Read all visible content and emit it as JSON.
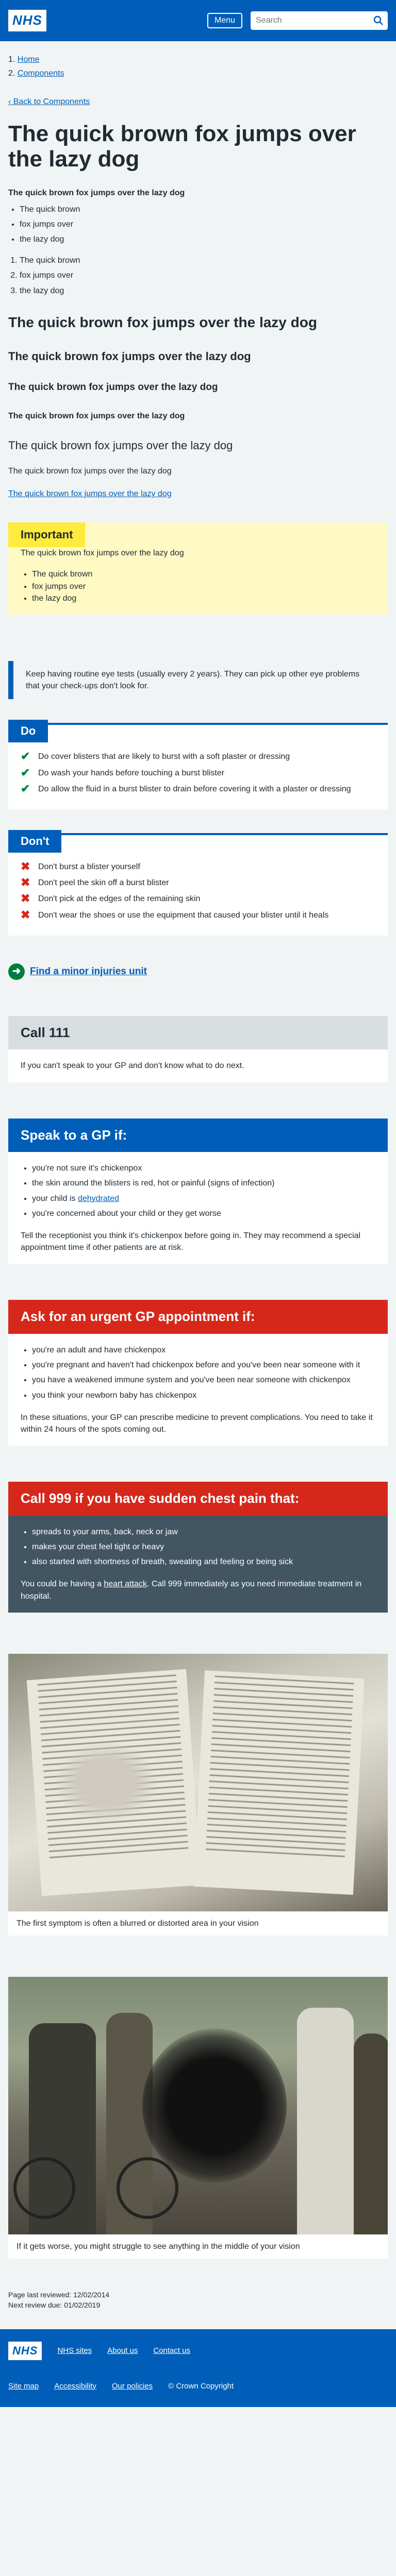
{
  "header": {
    "logo": "NHS",
    "menu": "Menu",
    "search_placeholder": "Search"
  },
  "breadcrumbs": [
    "Home",
    "Components"
  ],
  "back_link": "Back to Components",
  "title": "The quick brown fox jumps over the lazy dog",
  "bold_para": "The quick brown fox jumps over the lazy dog",
  "bullets": [
    "The quick brown",
    "fox jumps over",
    "the lazy dog"
  ],
  "numbered": [
    "The quick brown",
    "fox jumps over",
    "the lazy dog"
  ],
  "headings": {
    "h2": "The quick brown fox jumps over the lazy dog",
    "h3": "The quick brown fox jumps over the lazy dog",
    "h4": "The quick brown fox jumps over the lazy dog",
    "h5": "The quick brown fox jumps over the lazy dog",
    "normal": "The quick brown fox jumps over the lazy dog",
    "para": "The quick brown fox jumps over the lazy dog",
    "link": "The quick brown fox jumps over the lazy dog"
  },
  "important": {
    "tag": "Important",
    "text": "The quick brown fox jumps over the lazy dog",
    "items": [
      "The quick brown",
      "fox jumps over",
      "the lazy dog"
    ]
  },
  "inset_text": "Keep having routine eye tests (usually every 2 years). They can pick up other eye problems that your check-ups don't look for.",
  "do": {
    "tag": "Do",
    "items": [
      "Do cover blisters that are likely to burst with a soft plaster or dressing",
      "Do wash your hands before touching a burst blister",
      "Do allow the fluid in a burst blister to drain before covering it with a plaster or dressing"
    ]
  },
  "dont": {
    "tag": "Don't",
    "items": [
      "Don't burst a blister yourself",
      "Don't peel the skin off a burst blister",
      "Don't pick at the edges of the remaining skin",
      "Don't wear the shoes or use the equipment that caused your blister until it heals"
    ]
  },
  "action_link": "Find a minor injuries unit",
  "care_111": {
    "heading": "Call 111",
    "text": "If you can't speak to your GP and don't know what to do next."
  },
  "care_gp": {
    "heading": "Speak to a GP if:",
    "items": [
      "you're not sure it's chickenpox",
      "the skin around the blisters is red, hot or painful (signs of infection)",
      "your child is",
      "you're concerned about your child or they get worse"
    ],
    "dehydrated": "dehydrated",
    "text": "Tell the receptionist you think it's chickenpox before going in. They may recommend a special appointment time if other patients are at risk."
  },
  "care_urgent": {
    "heading": "Ask for an urgent GP appointment if:",
    "items": [
      "you're an adult and have chickenpox",
      "you're pregnant and haven't had chickenpox before and you've been near someone with it",
      "you have a weakened immune system and you've been near someone with chickenpox",
      "you think your newborn baby has chickenpox"
    ],
    "text": "In these situations, your GP can prescribe medicine to prevent complications. You need to take it within 24 hours of the spots coming out."
  },
  "care_999": {
    "heading": "Call 999 if you have sudden chest pain that:",
    "items": [
      "spreads to your arms, back, neck or jaw",
      "makes your chest feel tight or heavy",
      "also started with shortness of breath, sweating and feeling or being sick"
    ],
    "text_pre": "You could be having a",
    "link": "heart attack",
    "text_post": ". Call 999 immediately as you need immediate treatment in hospital."
  },
  "figure1_caption": "The first symptom is often a blurred or distorted area in your vision",
  "figure2_caption": "If it gets worse, you might struggle to see anything in the middle of your vision",
  "meta": {
    "last_reviewed": "Page last reviewed: 12/02/2014",
    "next_review": "Next review due: 01/02/2019"
  },
  "footer": {
    "logo": "NHS",
    "links1": [
      "NHS sites",
      "About us",
      "Contact us"
    ],
    "links2": [
      "Site map",
      "Accessibility",
      "Our policies"
    ],
    "copyright": "© Crown Copyright"
  }
}
